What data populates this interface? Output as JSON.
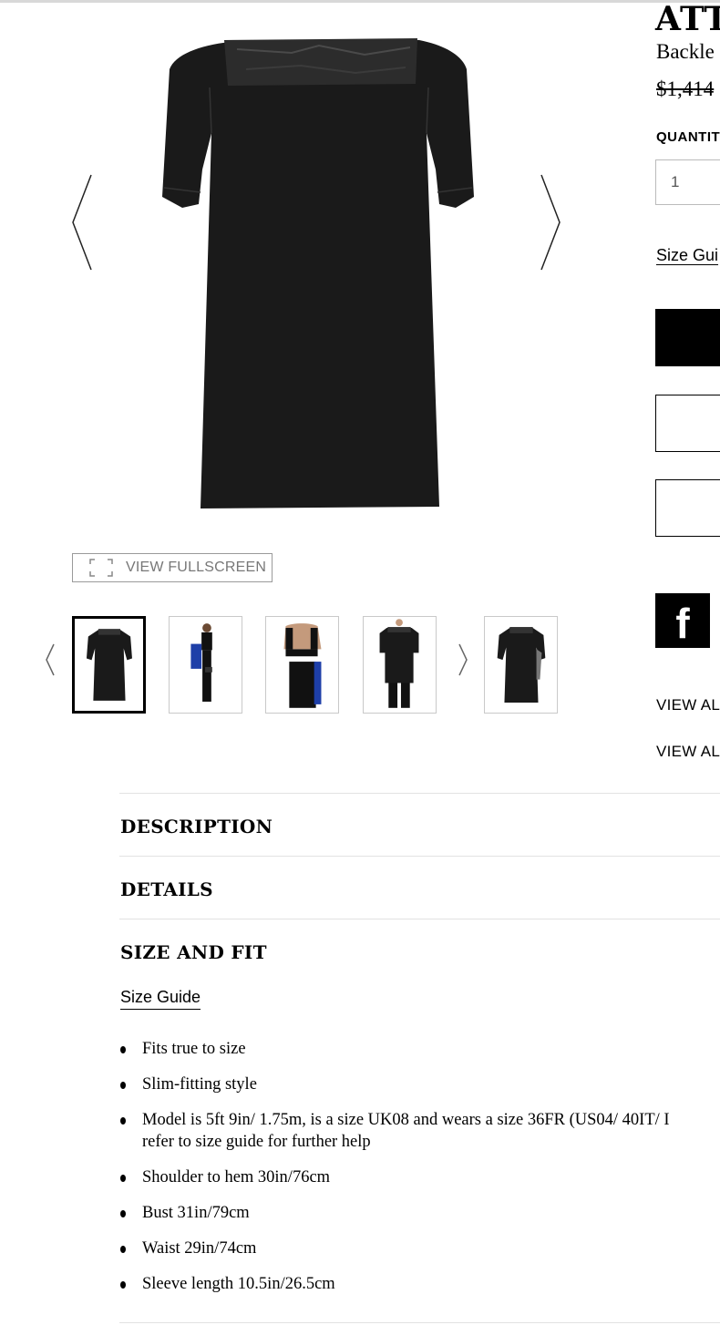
{
  "product": {
    "brand": "ATT",
    "name": "Backle",
    "price": "$1,414",
    "quantity_label": "QUANTIT",
    "quantity_value": "1",
    "size_guide_link": "Size Gui"
  },
  "gallery": {
    "fullscreen_label": "VIEW FULLSCREEN",
    "thumbnails": [
      {
        "view": "front",
        "selected": true
      },
      {
        "view": "side-model",
        "selected": false
      },
      {
        "view": "back-model",
        "selected": false
      },
      {
        "view": "front-model",
        "selected": false
      },
      {
        "view": "front-alt",
        "selected": false
      }
    ]
  },
  "social": {
    "facebook_icon": "f"
  },
  "links": {
    "view_all_1": "VIEW ALL",
    "view_all_2": "VIEW ALL"
  },
  "sections": {
    "description": "DESCRIPTION",
    "details": "DETAILS",
    "size_and_fit": "SIZE AND FIT",
    "size_guide": "Size Guide"
  },
  "size_fit_items": [
    "Fits true to size",
    "Slim-fitting style",
    "Model is 5ft 9in/ 1.75m, is a size UK08 and wears a size 36FR (US04/ 40IT/ I",
    "refer to size guide for further help",
    "Shoulder to hem 30in/76cm",
    "Bust 31in/79cm",
    "Waist 29in/74cm",
    "Sleeve length 10.5in/26.5cm"
  ],
  "colors": {
    "dress": "#1a1a1a",
    "leather": "#2c2c2c",
    "accent_blue": "#1e3fa8"
  }
}
